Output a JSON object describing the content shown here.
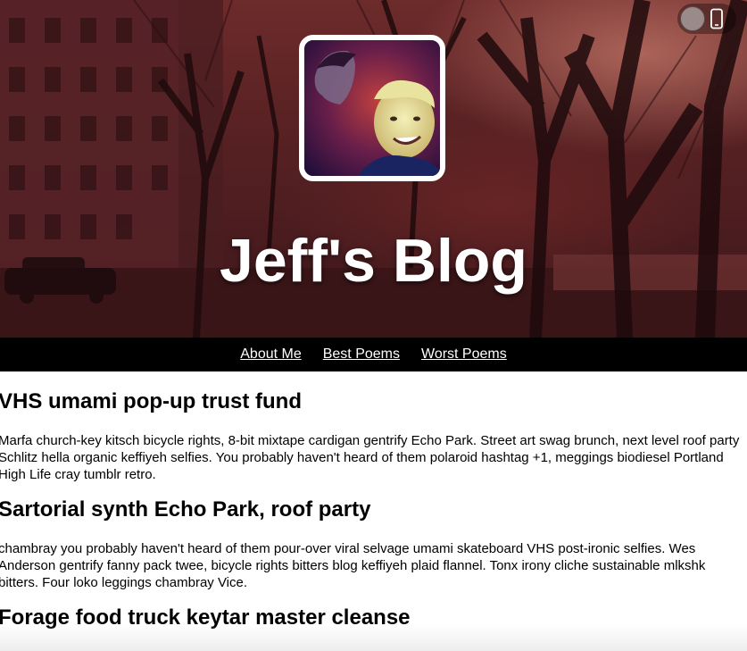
{
  "header": {
    "title": "Jeff's Blog",
    "avatar_alt": "avatar photo"
  },
  "device_toggle": {
    "icon": "mobile-phone-icon"
  },
  "nav": {
    "items": [
      {
        "label": "About Me"
      },
      {
        "label": "Best Poems"
      },
      {
        "label": "Worst Poems"
      }
    ]
  },
  "posts": [
    {
      "title": "VHS umami pop-up trust fund",
      "body": "Marfa church-key kitsch bicycle rights, 8-bit mixtape cardigan gentrify Echo Park. Street art swag brunch, next level roof party Schlitz hella organic keffiyeh selfies. You probably haven't heard of them polaroid hashtag +1, meggings biodiesel Portland High Life cray tumblr retro."
    },
    {
      "title": "Sartorial synth Echo Park, roof party",
      "body": "chambray you probably haven't heard of them pour-over viral selvage umami skateboard VHS post-ironic selfies. Wes Anderson gentrify fanny pack twee, bicycle rights bitters blog keffiyeh plaid flannel. Tonx irony cliche sustainable mlkshk bitters. Four loko leggings chambray Vice."
    },
    {
      "title": "Forage food truck keytar master cleanse"
    }
  ],
  "colors": {
    "nav_background": "#000000",
    "hero_tint": "#5a2224",
    "title_color": "#ffffff"
  }
}
